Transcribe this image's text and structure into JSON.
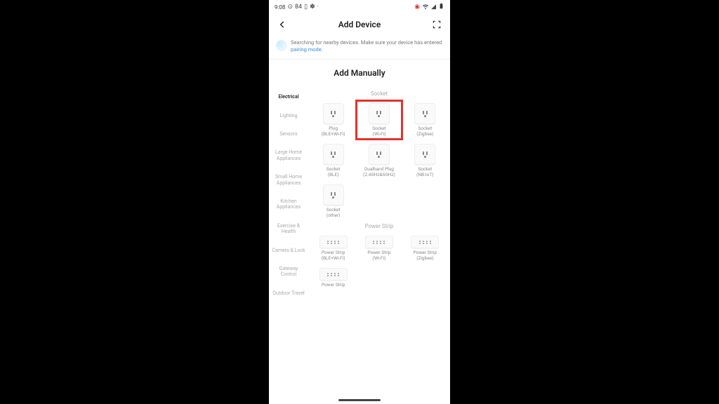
{
  "status": {
    "time": "9:08",
    "battery_label": "84"
  },
  "nav": {
    "title": "Add Device"
  },
  "searching": {
    "text": "Searching for nearby devices. Make sure your device has entered ",
    "link": "pairing mode."
  },
  "section": {
    "add_manually": "Add Manually"
  },
  "sidebar": {
    "items": [
      {
        "label": "Electrical",
        "active": true
      },
      {
        "label": "Lighting",
        "active": false
      },
      {
        "label": "Sensors",
        "active": false
      },
      {
        "label": "Large Home Appliances",
        "active": false
      },
      {
        "label": "Small Home Appliances",
        "active": false
      },
      {
        "label": "Kitchen Appliances",
        "active": false
      },
      {
        "label": "Exercise & Health",
        "active": false
      },
      {
        "label": "Camera & Lock",
        "active": false
      },
      {
        "label": "Gateway Control",
        "active": false
      },
      {
        "label": "Outdoor Travel",
        "active": false
      }
    ]
  },
  "groups": [
    {
      "title": "Socket",
      "items": [
        {
          "label": "Plug\n(BLE+Wi-Fi)",
          "type": "socket",
          "highlight": false
        },
        {
          "label": "Socket\n(Wi-Fi)",
          "type": "socket",
          "highlight": true
        },
        {
          "label": "Socket\n(Zigbee)",
          "type": "socket",
          "highlight": false
        },
        {
          "label": "Socket\n(BLE)",
          "type": "socket",
          "highlight": false
        },
        {
          "label": "Dualband Plug\n(2.4GHz&5GHz)",
          "type": "socket",
          "highlight": false
        },
        {
          "label": "Socket\n(NB-IoT)",
          "type": "socket",
          "highlight": false
        },
        {
          "label": "Socket\n(other)",
          "type": "socket",
          "highlight": false
        }
      ]
    },
    {
      "title": "Power Strip",
      "items": [
        {
          "label": "Power Strip\n(BLE+Wi-Fi)",
          "type": "strip",
          "highlight": false
        },
        {
          "label": "Power Strip\n(Wi-Fi)",
          "type": "strip",
          "highlight": false
        },
        {
          "label": "Power Strip\n(Zigbee)",
          "type": "strip",
          "highlight": false
        },
        {
          "label": "Power Strip",
          "type": "strip",
          "highlight": false
        }
      ]
    }
  ],
  "colors": {
    "highlight": "#e4322b",
    "link": "#3a8dde"
  }
}
